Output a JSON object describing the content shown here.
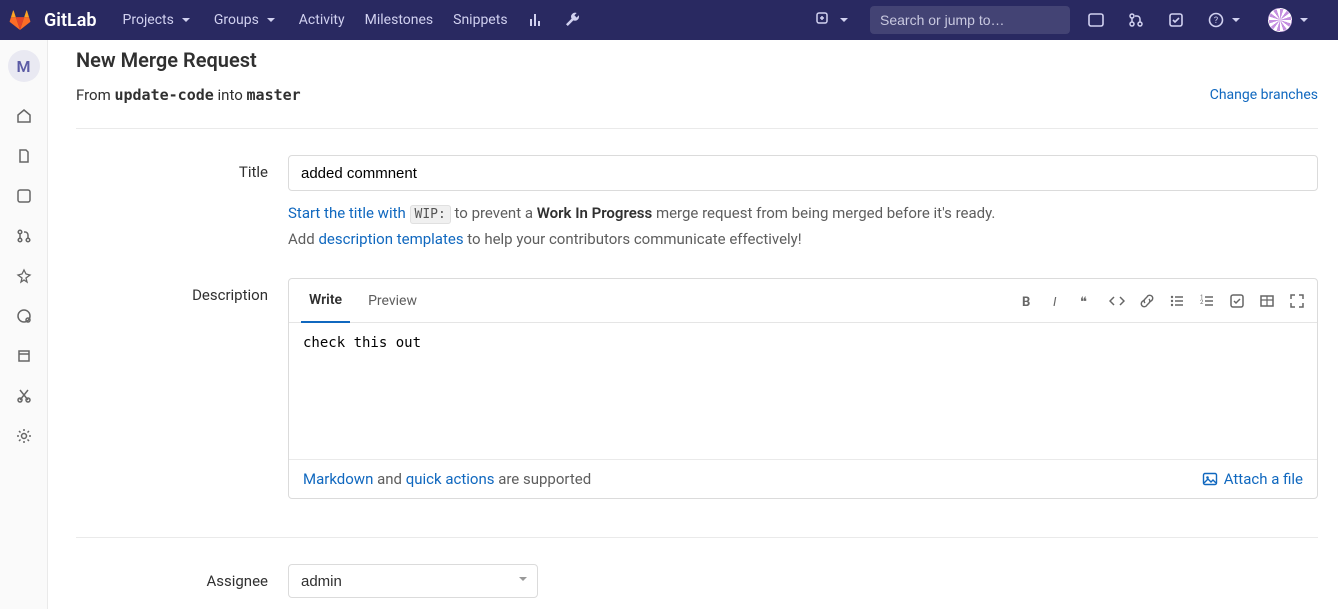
{
  "brand": "GitLab",
  "nav": {
    "projects": "Projects",
    "groups": "Groups",
    "activity": "Activity",
    "milestones": "Milestones",
    "snippets": "Snippets"
  },
  "search": {
    "placeholder": "Search or jump to…"
  },
  "sidebar": {
    "project_initial": "M"
  },
  "page": {
    "title": "New Merge Request",
    "from_label": "From ",
    "source_branch": "update-code",
    "into_label": " into ",
    "target_branch": "master",
    "change_branches": "Change branches"
  },
  "form": {
    "title_label": "Title",
    "title_value": "added commnent",
    "hint_start": "Start the title with ",
    "wip_chip": "WIP:",
    "hint_prevent": " to prevent a ",
    "wip_strong": "Work In Progress",
    "hint_tail": " merge request from being merged before it's ready.",
    "add_text": "Add ",
    "desc_templates_link": "description templates",
    "add_tail": " to help your contributors communicate effectively!",
    "description_label": "Description",
    "tab_write": "Write",
    "tab_preview": "Preview",
    "description_value": "check this out",
    "markdown_link": "Markdown",
    "and_text": " and ",
    "quick_actions_link": "quick actions",
    "supported_text": " are supported",
    "attach_file": "Attach a file",
    "assignee_label": "Assignee",
    "assignee_value": "admin"
  }
}
